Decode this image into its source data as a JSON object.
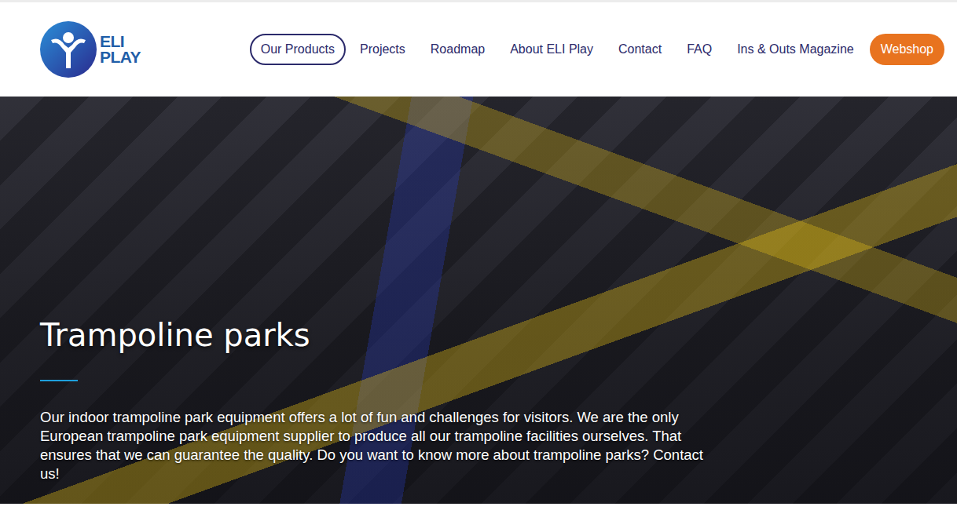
{
  "logo": {
    "lines": [
      "ELI",
      "PLAY"
    ]
  },
  "nav": [
    {
      "label": "Our Products",
      "selected": true
    },
    {
      "label": "Projects",
      "selected": false
    },
    {
      "label": "Roadmap",
      "selected": false
    },
    {
      "label": "About ELI Play",
      "selected": false
    },
    {
      "label": "Contact",
      "selected": false
    },
    {
      "label": "FAQ",
      "selected": false
    },
    {
      "label": "Ins & Outs Magazine",
      "selected": false
    }
  ],
  "webshop": {
    "label": "Webshop"
  },
  "hero": {
    "title": "Trampoline parks",
    "text": "Our indoor trampoline park equipment offers a lot of fun and challenges for visitors. We are the only European trampoline park equipment supplier to produce all our trampoline facilities ourselves. That ensures that we can guarantee the quality. Do you want to know more about trampoline parks? Contact us!"
  }
}
